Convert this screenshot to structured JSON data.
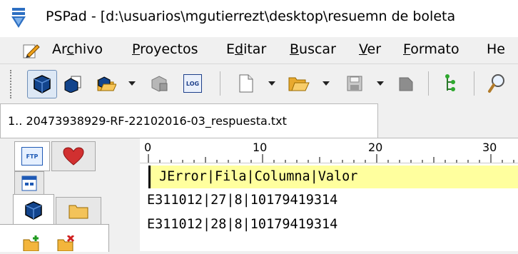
{
  "window": {
    "title": "PSPad - [d:\\usuarios\\mgutierrezt\\desktop\\resuemn de boleta"
  },
  "menu": {
    "items": [
      {
        "pre": "Ar",
        "u": "c",
        "post": "hivo"
      },
      {
        "pre": "",
        "u": "P",
        "post": "royectos"
      },
      {
        "pre": "E",
        "u": "d",
        "post": "itar"
      },
      {
        "pre": "",
        "u": "B",
        "post": "uscar"
      },
      {
        "pre": "",
        "u": "V",
        "post": "er"
      },
      {
        "pre": "",
        "u": "F",
        "post": "ormato"
      },
      {
        "pre": "He",
        "u": "",
        "post": ""
      }
    ]
  },
  "toolbar": {
    "log_label": "LOG"
  },
  "tabs": [
    {
      "label": "1.. 20473938929-RF-22102016-03_respuesta.txt",
      "active": true
    }
  ],
  "side_panel": {
    "ftp_label": "FTP"
  },
  "ruler": {
    "labels": [
      "0",
      "10",
      "20",
      "30"
    ]
  },
  "editor": {
    "lines": [
      "JError|Fila|Columna|Valor",
      "E311012|27|8|10179419314",
      "E311012|28|8|10179419314"
    ]
  },
  "colors": {
    "current_line": "#ffff9e",
    "accent": "#1a4f9c"
  }
}
